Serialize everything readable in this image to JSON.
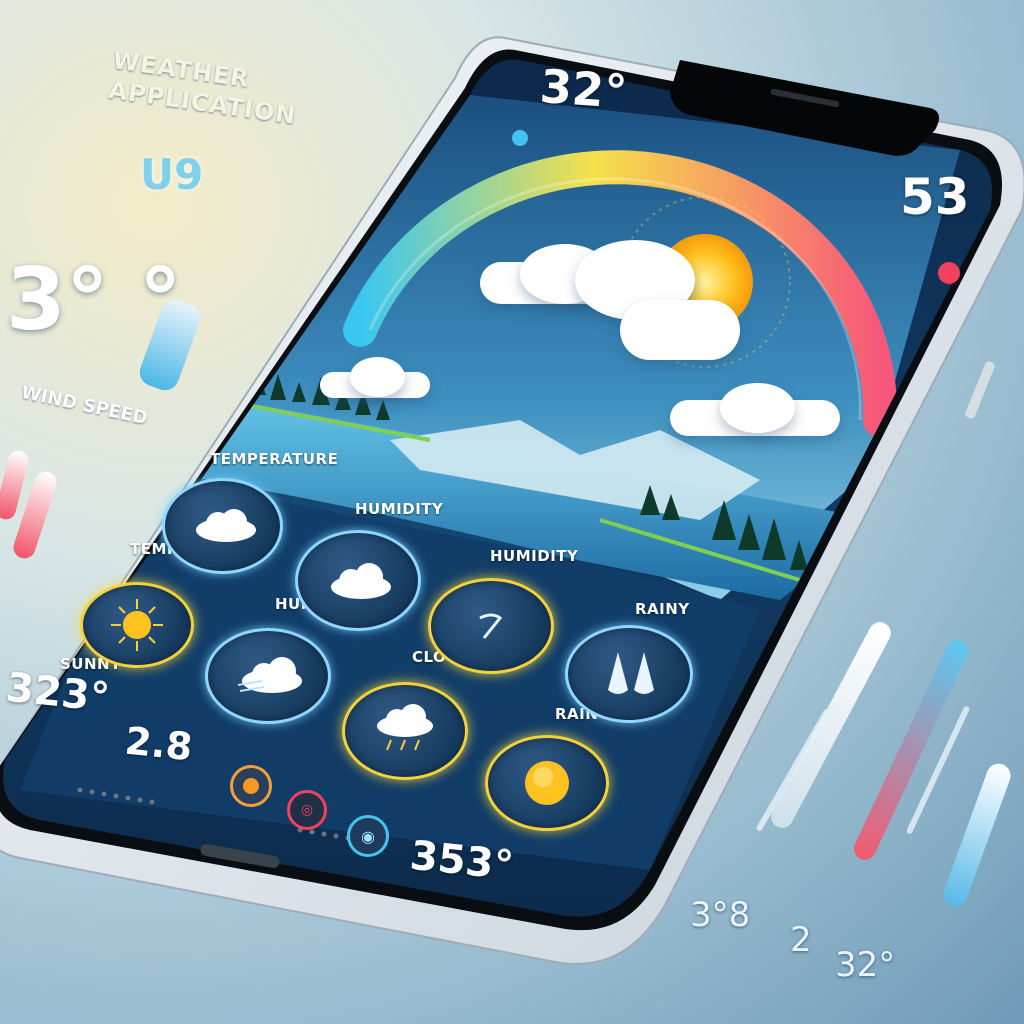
{
  "background": {
    "title_line1": "WEATHER",
    "title_line2": "APPLICATION",
    "uv_value": "U9",
    "big_temp": "3° °",
    "wind_label": "WIND SPEED",
    "bottom_values": [
      "3°8",
      "2",
      "32°"
    ]
  },
  "phone": {
    "status": {
      "top_temp": "32°",
      "right_value": "53"
    },
    "hero": {
      "arc_colors": [
        "#39c6f2",
        "#f6e04a",
        "#f7577a"
      ]
    },
    "conditions": [
      {
        "label": "TEMPERATURE",
        "icon": "cloud-icon"
      },
      {
        "label": "TEMPERATURE",
        "icon": "cloud-icon"
      },
      {
        "label": "HUMIDITY",
        "icon": "cloud-icon"
      },
      {
        "label": "HUMIDITY",
        "icon": "humidity-dial-icon"
      },
      {
        "label": "RAINY",
        "icon": "raindrops-icon"
      },
      {
        "label": "SUNNY",
        "icon": "sun-icon"
      },
      {
        "label": "CLOUDY",
        "icon": "cloud-icon"
      },
      {
        "label": "RAINY",
        "icon": "storm-cloud-icon"
      },
      {
        "label": "SUNNY",
        "icon": "sun-icon"
      }
    ],
    "bottom": {
      "temp_left": "323°",
      "temp_mid": "2.8",
      "temp_right": "353°"
    }
  },
  "colors": {
    "accent_blue": "#8fd7ff",
    "accent_yellow": "#f2d23c",
    "accent_red": "#f2405e",
    "screen_dark": "#0f2f52"
  }
}
